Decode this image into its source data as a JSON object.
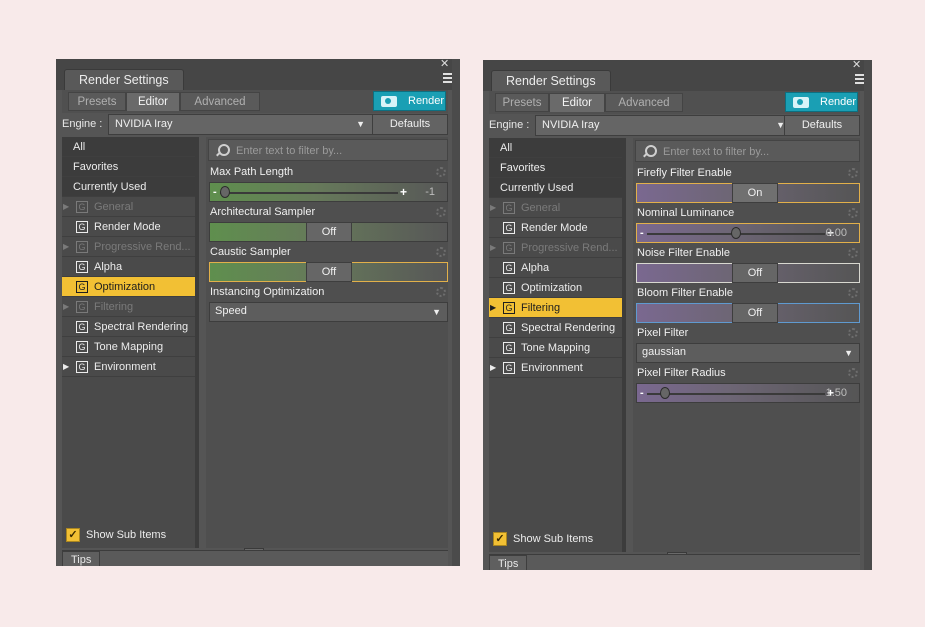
{
  "panels": [
    {
      "title": "Render Settings",
      "tabs": [
        "Presets",
        "Editor",
        "Advanced"
      ],
      "active_tab": "Editor",
      "render_label": "Render",
      "engine_label": "Engine :",
      "engine_value": "NVIDIA Iray",
      "defaults_label": "Defaults",
      "filter_placeholder": "Enter text to filter by...",
      "show_sub_items": "Show Sub Items",
      "tips_label": "Tips",
      "sidebar": [
        {
          "label": "All",
          "kind": "top"
        },
        {
          "label": "Favorites",
          "kind": "top"
        },
        {
          "label": "Currently Used",
          "kind": "top"
        },
        {
          "label": "General",
          "kind": "group",
          "expandable": true,
          "dim": true
        },
        {
          "label": "Render Mode",
          "kind": "group"
        },
        {
          "label": "Progressive Rend...",
          "kind": "group",
          "expandable": true,
          "dim": true
        },
        {
          "label": "Alpha",
          "kind": "group"
        },
        {
          "label": "Optimization",
          "kind": "group",
          "selected": true
        },
        {
          "label": "Filtering",
          "kind": "group",
          "expandable": true,
          "dim": true
        },
        {
          "label": "Spectral Rendering",
          "kind": "group"
        },
        {
          "label": "Tone Mapping",
          "kind": "group"
        },
        {
          "label": "Environment",
          "kind": "group",
          "expandable": true
        }
      ],
      "properties": [
        {
          "label": "Max Path Length",
          "type": "slider",
          "value": "-1",
          "level": 0.0
        },
        {
          "label": "Architectural Sampler",
          "type": "toggle",
          "value": "Off"
        },
        {
          "label": "Caustic Sampler",
          "type": "toggle",
          "value": "Off",
          "highlight": "gold"
        },
        {
          "label": "Instancing Optimization",
          "type": "select",
          "value": "Speed"
        }
      ]
    },
    {
      "title": "Render Settings",
      "tabs": [
        "Presets",
        "Editor",
        "Advanced"
      ],
      "active_tab": "Editor",
      "render_label": "Render",
      "engine_label": "Engine :",
      "engine_value": "NVIDIA Iray",
      "defaults_label": "Defaults",
      "filter_placeholder": "Enter text to filter by...",
      "show_sub_items": "Show Sub Items",
      "tips_label": "Tips",
      "sidebar": [
        {
          "label": "All",
          "kind": "top"
        },
        {
          "label": "Favorites",
          "kind": "top"
        },
        {
          "label": "Currently Used",
          "kind": "top"
        },
        {
          "label": "General",
          "kind": "group",
          "expandable": true,
          "dim": true
        },
        {
          "label": "Render Mode",
          "kind": "group"
        },
        {
          "label": "Progressive Rend...",
          "kind": "group",
          "expandable": true,
          "dim": true
        },
        {
          "label": "Alpha",
          "kind": "group"
        },
        {
          "label": "Optimization",
          "kind": "group"
        },
        {
          "label": "Filtering",
          "kind": "group",
          "expandable": true,
          "selected": true
        },
        {
          "label": "Spectral Rendering",
          "kind": "group"
        },
        {
          "label": "Tone Mapping",
          "kind": "group"
        },
        {
          "label": "Environment",
          "kind": "group",
          "expandable": true
        }
      ],
      "properties": [
        {
          "label": "Firefly Filter Enable",
          "type": "toggle",
          "value": "On",
          "highlight": "gold"
        },
        {
          "label": "Nominal Luminance",
          "type": "slider",
          "value": "0.00",
          "level": 0.5,
          "highlight": "gold"
        },
        {
          "label": "Noise Filter Enable",
          "type": "toggle",
          "value": "Off",
          "highlight": "white"
        },
        {
          "label": "Bloom Filter Enable",
          "type": "toggle",
          "value": "Off",
          "highlight": "blue"
        },
        {
          "label": "Pixel Filter",
          "type": "select",
          "value": "gaussian"
        },
        {
          "label": "Pixel Filter Radius",
          "type": "slider",
          "value": "1.50",
          "level": 0.08
        }
      ]
    }
  ],
  "colors": {
    "accent": "#f2c034",
    "render_button": "#1a9fb4",
    "panel_bg": "#555555"
  }
}
